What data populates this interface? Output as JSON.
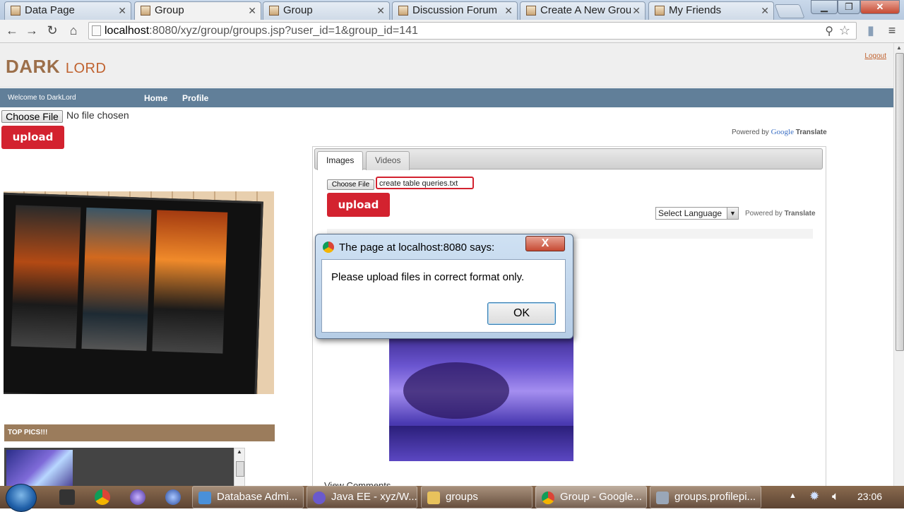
{
  "browser": {
    "tabs": [
      {
        "label": "Data Page"
      },
      {
        "label": "Group"
      },
      {
        "label": "Group"
      },
      {
        "label": "Discussion Forum"
      },
      {
        "label": "Create A New Grou"
      },
      {
        "label": "My Friends"
      }
    ],
    "url_host": "localhost",
    "url_rest": ":8080/xyz/group/groups.jsp?user_id=1&group_id=141"
  },
  "header": {
    "logo_main": "DARK",
    "logo_sub": "LORD",
    "logout": "Logout"
  },
  "nav": {
    "welcome": "Welcome to DarkLord",
    "home": "Home",
    "profile": "Profile"
  },
  "left": {
    "choose_file": "Choose File",
    "no_file": "No file chosen",
    "upload": "upload",
    "top_pics": "TOP PICS!!!"
  },
  "translate": {
    "powered_by": "Powered by",
    "google": "Google",
    "translate": "Translate",
    "select_language": "Select Language"
  },
  "panel": {
    "tabs": [
      "Images",
      "Videos"
    ],
    "choose_file": "Choose File",
    "file_name": "create table queries.txt",
    "upload": "upload",
    "view_comments": "View Comments"
  },
  "dialog": {
    "title": "The page at localhost:8080 says:",
    "message": "Please upload files in correct format only.",
    "ok": "OK",
    "close": "X"
  },
  "taskbar": {
    "tasks": [
      {
        "label": "Database Admi..."
      },
      {
        "label": "Java EE - xyz/W..."
      },
      {
        "label": "groups"
      },
      {
        "label": "Group - Google..."
      },
      {
        "label": "groups.profilepi..."
      }
    ],
    "clock": "23:06"
  },
  "colors": {
    "accent_red": "#d3222f",
    "nav_blue": "#617f99",
    "brown_bar": "#9b7c5c"
  }
}
